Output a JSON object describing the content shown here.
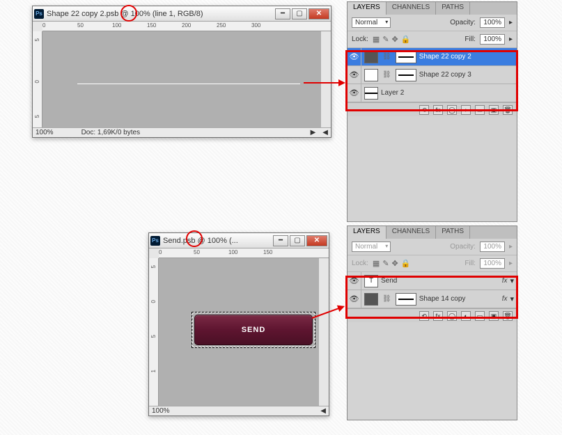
{
  "window1": {
    "title": "Shape 22 copy 2.psb @ 100% (line 1, RGB/8)",
    "zoom": "100%",
    "doc_info": "Doc: 1,69K/0 bytes",
    "ruler_h": [
      "0",
      "50",
      "100",
      "150",
      "200",
      "250",
      "300"
    ],
    "ruler_v": [
      "5",
      "0",
      "5"
    ]
  },
  "window2": {
    "title": "Send.psb @ 100% (...",
    "zoom": "100%",
    "ruler_h": [
      "0",
      "50",
      "100",
      "150"
    ],
    "ruler_v": [
      "5",
      "0",
      "5",
      "1"
    ],
    "button_text": "SEND"
  },
  "panel1": {
    "tabs": [
      "LAYERS",
      "CHANNELS",
      "PATHS"
    ],
    "blend": "Normal",
    "opacity_label": "Opacity:",
    "opacity": "100%",
    "lock_label": "Lock:",
    "fill_label": "Fill:",
    "fill": "100%",
    "layers": [
      {
        "name": "Shape 22 copy 2",
        "selected": true
      },
      {
        "name": "Shape 22 copy 3",
        "selected": false
      },
      {
        "name": "Layer 2",
        "selected": false
      }
    ]
  },
  "panel2": {
    "tabs": [
      "LAYERS",
      "CHANNELS",
      "PATHS"
    ],
    "blend": "Normal",
    "opacity_label": "Opacity:",
    "opacity": "100%",
    "lock_label": "Lock:",
    "fill_label": "Fill:",
    "fill": "100%",
    "layers": [
      {
        "name": "Send",
        "type": "T",
        "fx": true
      },
      {
        "name": "Shape 14 copy",
        "type": "shape",
        "fx": true
      }
    ]
  },
  "fx_label": "fx"
}
